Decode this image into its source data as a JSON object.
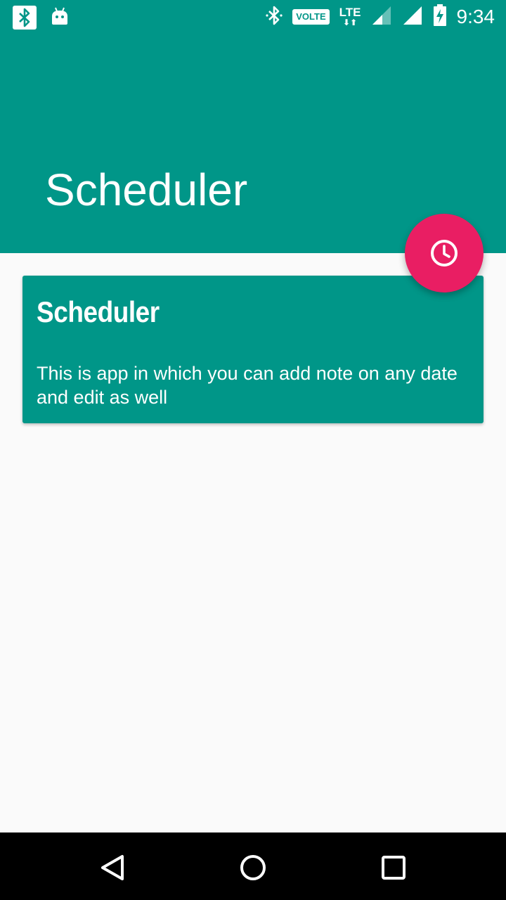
{
  "status_bar": {
    "time": "9:34",
    "volte_label": "VOLTE",
    "network_label": "LTE",
    "icons": [
      "bluetooth-notification-icon",
      "android-icon",
      "bluetooth-icon",
      "volte-icon",
      "lte-icon",
      "signal-icon",
      "signal-icon",
      "battery-charging-icon"
    ]
  },
  "app_bar": {
    "title": "Scheduler"
  },
  "fab": {
    "icon": "clock-icon",
    "color": "#e91e63"
  },
  "cards": [
    {
      "title": "Scheduler",
      "description": "This is app in which you can add note on any date and edit as well"
    }
  ],
  "nav_bar": {
    "buttons": [
      "back-icon",
      "home-icon",
      "recents-icon"
    ]
  },
  "colors": {
    "primary": "#009688",
    "accent": "#e91e63",
    "background": "#fafafa"
  }
}
